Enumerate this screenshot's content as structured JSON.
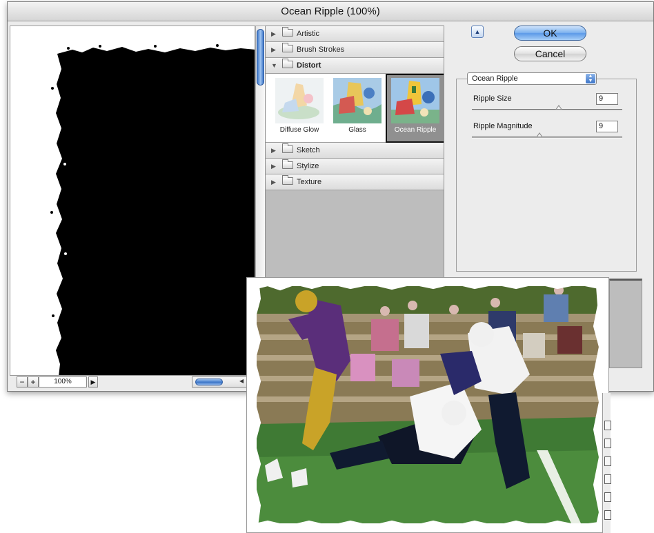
{
  "window": {
    "title": "Ocean Ripple (100%)"
  },
  "preview": {
    "zoom_out": "−",
    "zoom_in": "+",
    "zoom_level": "100%"
  },
  "gallery": {
    "categories": [
      {
        "label": "Artistic",
        "expanded": false
      },
      {
        "label": "Brush Strokes",
        "expanded": false
      },
      {
        "label": "Distort",
        "expanded": true
      },
      {
        "label": "Sketch",
        "expanded": false
      },
      {
        "label": "Stylize",
        "expanded": false
      },
      {
        "label": "Texture",
        "expanded": false
      }
    ],
    "distort_filters": [
      {
        "label": "Diffuse Glow",
        "selected": false
      },
      {
        "label": "Glass",
        "selected": false
      },
      {
        "label": "Ocean Ripple",
        "selected": true
      }
    ]
  },
  "buttons": {
    "ok": "OK",
    "cancel": "Cancel"
  },
  "settings": {
    "filter": "Ocean Ripple",
    "params": [
      {
        "label": "Ripple Size",
        "value": "9",
        "slider_fraction": 0.58
      },
      {
        "label": "Ripple Magnitude",
        "value": "9",
        "slider_fraction": 0.45
      }
    ]
  },
  "colors": {
    "accent": "#5c9ae8",
    "dialog_bg": "#ececec",
    "gallery_bg": "#bdbdbd"
  }
}
